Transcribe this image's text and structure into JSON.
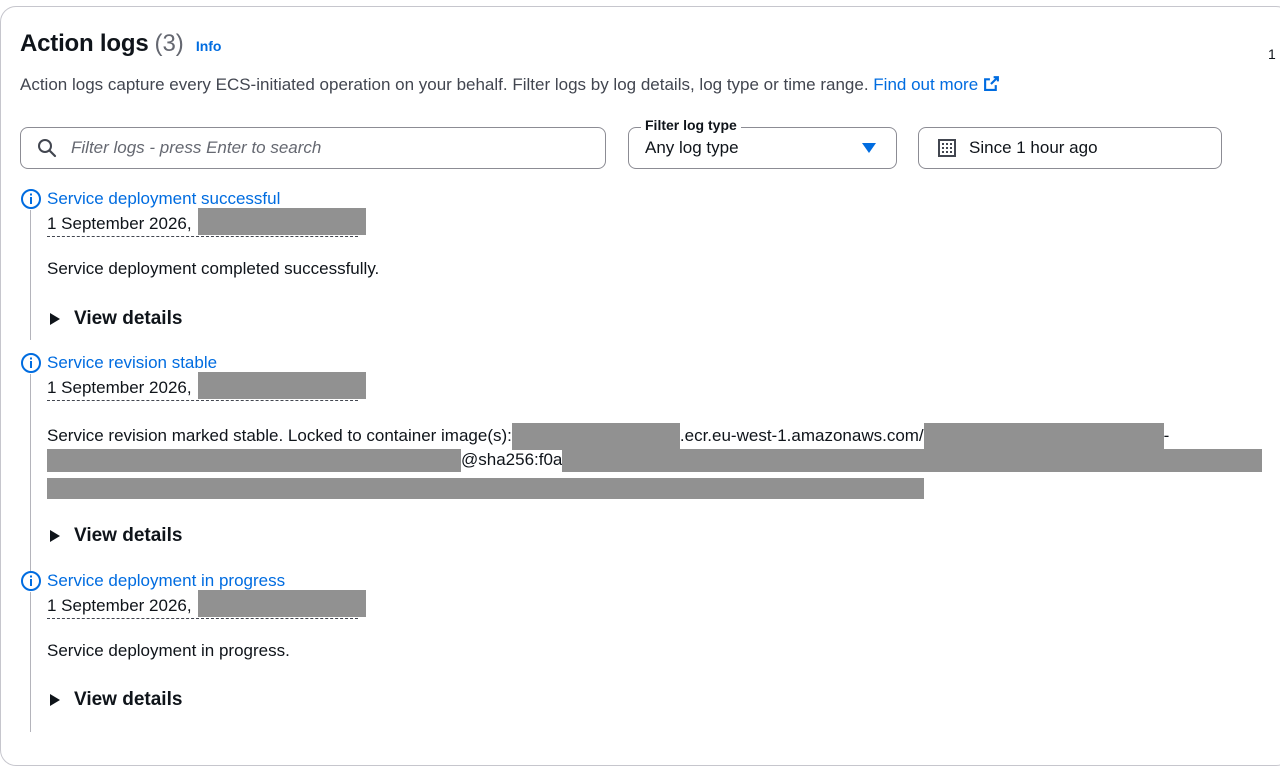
{
  "header": {
    "title": "Action logs",
    "count": "(3)",
    "info_link": "Info",
    "page_number": "1"
  },
  "description": {
    "text": "Action logs capture every ECS-initiated operation on your behalf. Filter logs by log details, log type or time range. ",
    "link": "Find out more"
  },
  "filters": {
    "search_placeholder": "Filter logs - press Enter to search",
    "log_type_label": "Filter log type",
    "log_type_value": "Any log type",
    "time_range": "Since 1 hour ago"
  },
  "logs": [
    {
      "title": "Service deployment successful",
      "timestamp": "1 September 2026,",
      "message": "Service deployment completed successfully.",
      "details_label": "View details"
    },
    {
      "title": "Service revision stable",
      "timestamp": "1 September 2026,",
      "message_prefix": "Service revision marked stable. Locked to container image(s):",
      "message_domain": ".ecr.eu-west-1.amazonaws.com/",
      "message_dash": "-",
      "message_sha": "@sha256:f0a",
      "details_label": "View details"
    },
    {
      "title": "Service deployment in progress",
      "timestamp": "1 September 2026,",
      "message": "Service deployment in progress.",
      "details_label": "View details"
    }
  ],
  "icons": {
    "search": "search-icon",
    "dropdown": "caret-down-icon",
    "calendar": "calendar-icon",
    "info": "info-icon",
    "external": "external-link-icon",
    "expand": "caret-right-icon"
  },
  "colors": {
    "link": "#006ce0",
    "text": "#0f141a",
    "muted": "#424650",
    "redaction": "#919191"
  }
}
